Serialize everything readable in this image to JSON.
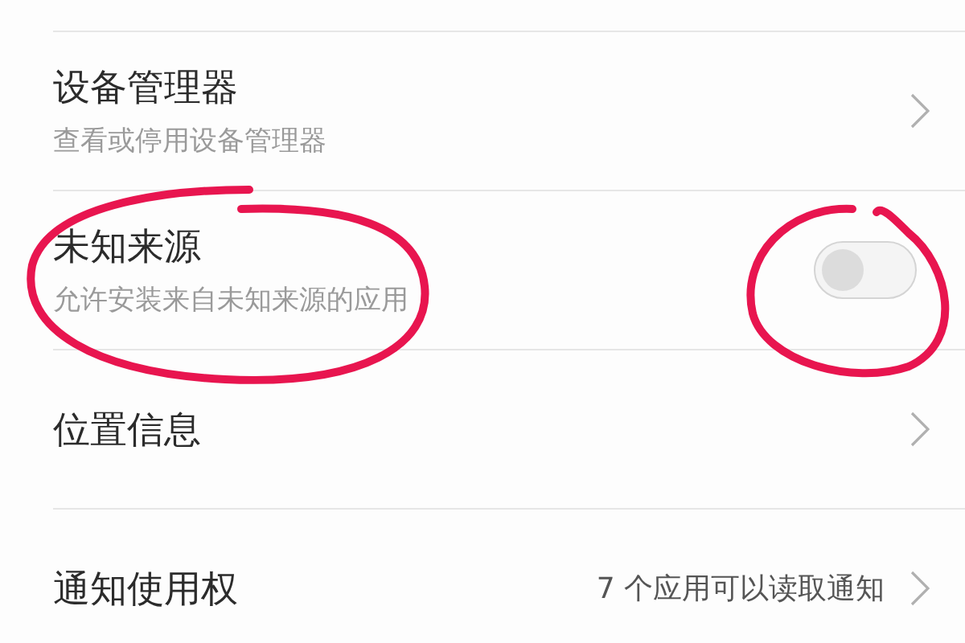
{
  "settings": [
    {
      "kind": "link",
      "title": "设备管理器",
      "subtitle": "查看或停用设备管理器"
    },
    {
      "kind": "toggle",
      "title": "未知来源",
      "subtitle": "允许安装来自未知来源的应用",
      "on": false
    },
    {
      "kind": "link",
      "title": "位置信息"
    },
    {
      "kind": "link",
      "title": "通知使用权",
      "value": "7 个应用可以读取通知"
    }
  ],
  "annotations": [
    {
      "kind": "circle"
    },
    {
      "kind": "circle"
    }
  ]
}
